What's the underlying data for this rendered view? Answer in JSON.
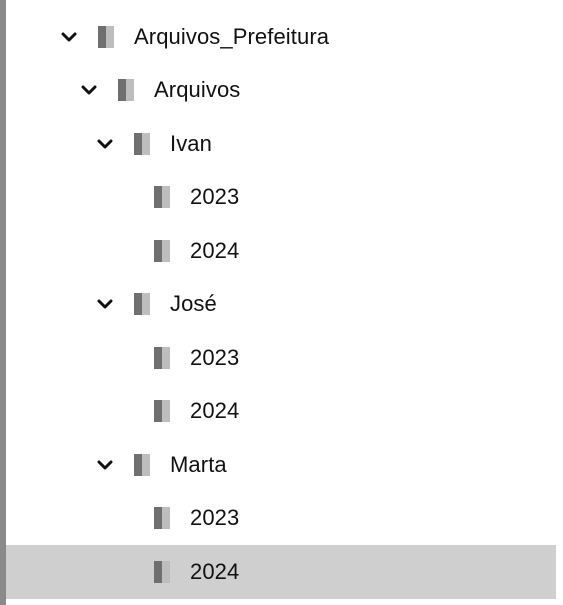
{
  "tree": {
    "items": [
      {
        "label": "Arquivos_Prefeitura",
        "level": 0,
        "expanded": true,
        "selected": false
      },
      {
        "label": "Arquivos",
        "level": 1,
        "expanded": true,
        "selected": false
      },
      {
        "label": "Ivan",
        "level": 2,
        "expanded": true,
        "selected": false
      },
      {
        "label": "2023",
        "level": 3,
        "expanded": null,
        "selected": false
      },
      {
        "label": "2024",
        "level": 3,
        "expanded": null,
        "selected": false
      },
      {
        "label": "José",
        "level": 2,
        "expanded": true,
        "selected": false
      },
      {
        "label": "2023",
        "level": 3,
        "expanded": null,
        "selected": false
      },
      {
        "label": "2024",
        "level": 3,
        "expanded": null,
        "selected": false
      },
      {
        "label": "Marta",
        "level": 2,
        "expanded": true,
        "selected": false
      },
      {
        "label": "2023",
        "level": 3,
        "expanded": null,
        "selected": false
      },
      {
        "label": "2024",
        "level": 3,
        "expanded": null,
        "selected": true
      }
    ],
    "icons": {
      "expander": "chevron-down-icon",
      "node": "folder-icon"
    },
    "colors": {
      "selection": "#cfcfcf",
      "folder_dark": "#6f6f6f",
      "folder_light": "#bdbdbd",
      "border": "#8a8a8a"
    }
  }
}
